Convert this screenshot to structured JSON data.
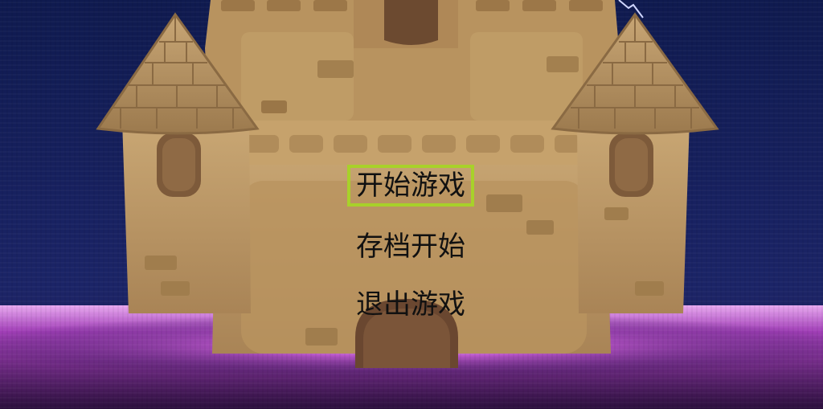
{
  "game": {
    "menu": {
      "start_label": "开始游戏",
      "load_label": "存档开始",
      "exit_label": "退出游戏",
      "selected": "start"
    }
  },
  "colors": {
    "sky": "#17225f",
    "glow": "#c25bd1",
    "castle": "#b08a5a",
    "castle_dark": "#7a5a36",
    "selection": "#a8d12a",
    "menu_text": "#111111"
  }
}
